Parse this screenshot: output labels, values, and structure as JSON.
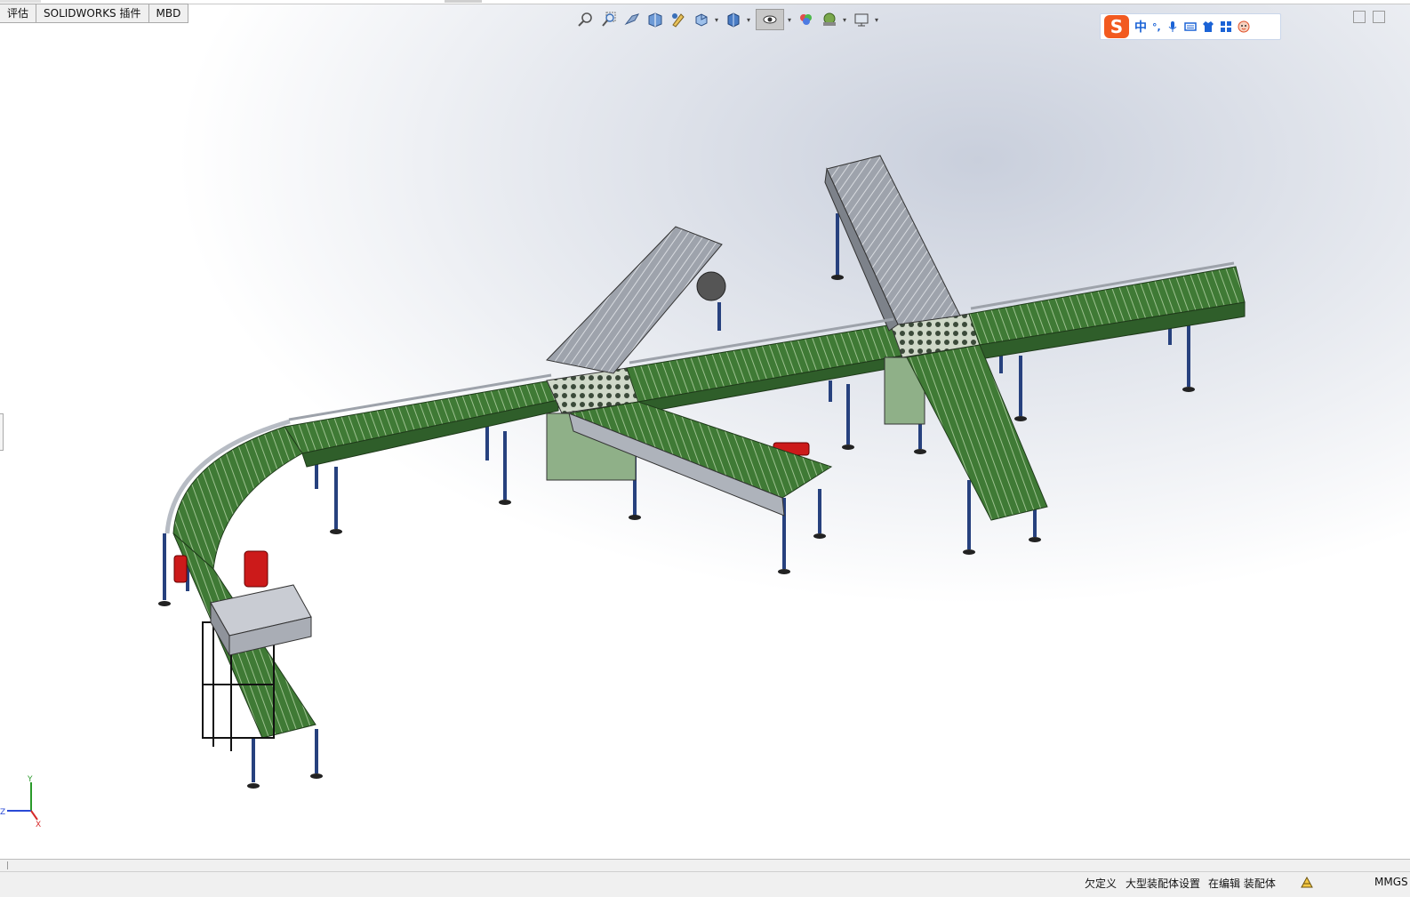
{
  "tabs": [
    {
      "label": "评估"
    },
    {
      "label": "SOLIDWORKS 插件"
    },
    {
      "label": "MBD"
    }
  ],
  "heads_up_toolbar": [
    {
      "icon": "zoom-to-fit-icon"
    },
    {
      "icon": "zoom-to-area-icon"
    },
    {
      "icon": "previous-view-icon"
    },
    {
      "icon": "section-view-icon"
    },
    {
      "icon": "dynamic-annotation-icon"
    },
    {
      "icon": "view-orientation-icon"
    },
    {
      "icon": "display-style-icon"
    },
    {
      "icon": "hide-show-items-icon"
    },
    {
      "icon": "edit-appearance-icon"
    },
    {
      "icon": "apply-scene-icon"
    },
    {
      "icon": "view-settings-icon"
    }
  ],
  "ime": {
    "logo": "S",
    "mode": "中",
    "punct": "°,"
  },
  "triad": {
    "y": "Y",
    "z": "Z",
    "x": "X"
  },
  "status": {
    "under_defined": "欠定义",
    "large_assembly": "大型装配体设置",
    "editing": "在编辑 装配体",
    "units": "MMGS"
  },
  "colors": {
    "conveyor_green": "#3f7a35",
    "leg_blue": "#27417e",
    "roller_gray": "#b8bcc4",
    "motor_red": "#cc1a1a"
  }
}
